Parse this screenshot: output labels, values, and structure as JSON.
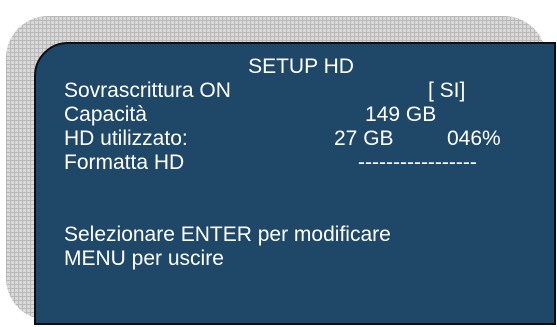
{
  "menu": {
    "title": "SETUP HD",
    "rows": [
      {
        "label": "Sovrascrittura ON",
        "value": "[ SI]",
        "extra": ""
      },
      {
        "label": "Capacità",
        "value": "149 GB",
        "extra": ""
      },
      {
        "label": "HD utilizzato:",
        "value": "27 GB",
        "extra": "046%"
      },
      {
        "label": "Formatta HD",
        "value": "-----------------",
        "extra": ""
      }
    ],
    "instructions": [
      "Selezionare ENTER per modificare",
      "MENU per uscire"
    ]
  },
  "colors": {
    "panel": "#1e4768",
    "text": "#ffffff",
    "grid": "#d9d9d9"
  }
}
